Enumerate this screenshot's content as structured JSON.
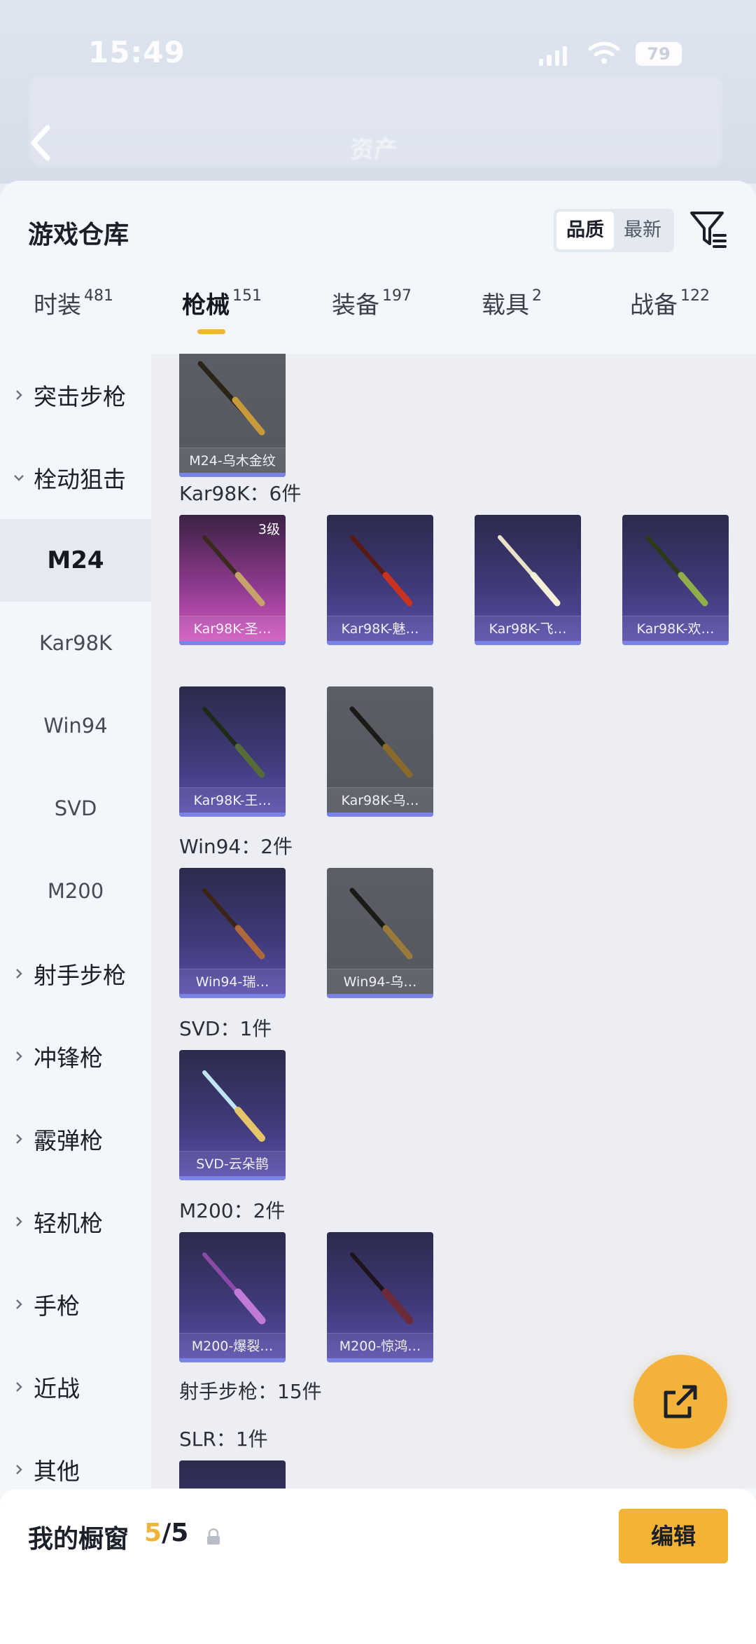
{
  "status_bar": {
    "time": "15:49",
    "battery": "79"
  },
  "header": {
    "back_title_blurred": "资产"
  },
  "sheet": {
    "title": "游戏仓库",
    "sort_options": [
      "品质",
      "最新"
    ],
    "sort_active": "品质"
  },
  "tabs": [
    {
      "label": "时装",
      "count": "481"
    },
    {
      "label": "枪械",
      "count": "151"
    },
    {
      "label": "装备",
      "count": "197"
    },
    {
      "label": "载具",
      "count": "2"
    },
    {
      "label": "战备",
      "count": "122"
    }
  ],
  "sidebar": {
    "items": [
      {
        "label": "突击步枪"
      },
      {
        "label": "栓动狙击"
      },
      {
        "label": "M24"
      },
      {
        "label": "Kar98K"
      },
      {
        "label": "Win94"
      },
      {
        "label": "SVD"
      },
      {
        "label": "M200"
      },
      {
        "label": "射手步枪"
      },
      {
        "label": "冲锋枪"
      },
      {
        "label": "霰弹枪"
      },
      {
        "label": "轻机枪"
      },
      {
        "label": "手枪"
      },
      {
        "label": "近战"
      },
      {
        "label": "其他"
      }
    ]
  },
  "content": {
    "groups": [
      {
        "title": "Kar98K：6件"
      },
      {
        "title": "Win94：2件"
      },
      {
        "title": "SVD：1件"
      },
      {
        "title": "M200：2件"
      },
      {
        "title": "射手步枪：15件"
      },
      {
        "title": "SLR：1件"
      }
    ],
    "cards": [
      {
        "name": "M24-乌木金纹",
        "level": ""
      },
      {
        "name": "Kar98K-圣…",
        "level": "3级"
      },
      {
        "name": "Kar98K-魅…",
        "level": ""
      },
      {
        "name": "Kar98K-飞…",
        "level": ""
      },
      {
        "name": "Kar98K-欢…",
        "level": ""
      },
      {
        "name": "Kar98K-王…",
        "level": ""
      },
      {
        "name": "Kar98K-乌…",
        "level": ""
      },
      {
        "name": "Win94-瑞…",
        "level": ""
      },
      {
        "name": "Win94-乌…",
        "level": ""
      },
      {
        "name": "SVD-云朵鹊",
        "level": ""
      },
      {
        "name": "M200-爆裂…",
        "level": ""
      },
      {
        "name": "M200-惊鸿…",
        "level": ""
      }
    ]
  },
  "bottom_bar": {
    "label": "我的橱窗",
    "count_current": "5",
    "count_total": "/5",
    "edit_label": "编辑"
  },
  "colors": {
    "accent": "#f2b233",
    "tab_underline": "#f0b43a",
    "card_bar": "#7b83e6"
  }
}
